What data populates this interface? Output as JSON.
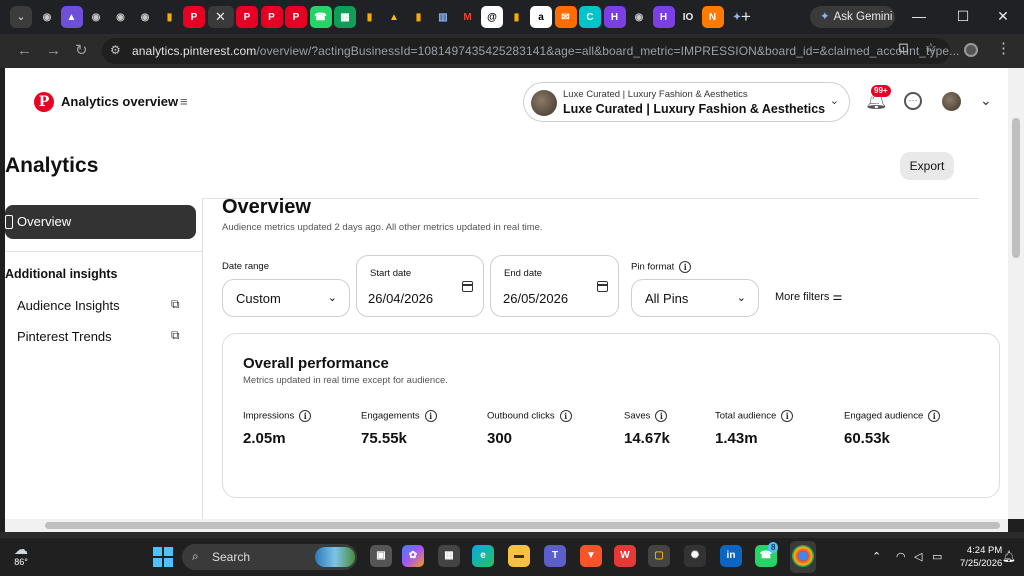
{
  "browser": {
    "tab_icons": [
      {
        "name": "chrome-tab-icon",
        "glyph": "◉",
        "color": "#c4c7c5",
        "bg": ""
      },
      {
        "name": "app-tab-icon",
        "glyph": "▲",
        "color": "#fff",
        "bg": "#6e4fd8"
      },
      {
        "name": "chrome-tab-icon",
        "glyph": "◉",
        "color": "#c4c7c5",
        "bg": ""
      },
      {
        "name": "chrome-tab-icon",
        "glyph": "◉",
        "color": "#c4c7c5",
        "bg": ""
      },
      {
        "name": "chrome-tab-icon",
        "glyph": "◉",
        "color": "#c4c7c5",
        "bg": ""
      },
      {
        "name": "analytics-tab-icon",
        "glyph": "▮",
        "color": "#f9ab00",
        "bg": ""
      },
      {
        "name": "pinterest-tab-icon",
        "glyph": "P",
        "color": "#fff",
        "bg": "#e60023"
      },
      {
        "name": "close-tab-icon",
        "glyph": "✕",
        "color": "#e8eaed",
        "bg": "",
        "active": true
      },
      {
        "name": "pinterest-tab-icon",
        "glyph": "P",
        "color": "#fff",
        "bg": "#e60023"
      },
      {
        "name": "pinterest-tab-icon",
        "glyph": "P",
        "color": "#fff",
        "bg": "#e60023"
      },
      {
        "name": "pinterest-tab-icon",
        "glyph": "P",
        "color": "#fff",
        "bg": "#e60023"
      },
      {
        "name": "whatsapp-tab-icon",
        "glyph": "☎",
        "color": "#fff",
        "bg": "#25d366"
      },
      {
        "name": "sheets-tab-icon",
        "glyph": "▦",
        "color": "#fff",
        "bg": "#0f9d58"
      },
      {
        "name": "analytics-tab-icon",
        "glyph": "▮",
        "color": "#f9ab00",
        "bg": ""
      },
      {
        "name": "ads-tab-icon",
        "glyph": "▲",
        "color": "#fbbc04",
        "bg": ""
      },
      {
        "name": "analytics-tab-icon",
        "glyph": "▮",
        "color": "#f9ab00",
        "bg": ""
      },
      {
        "name": "bank-tab-icon",
        "glyph": "▥",
        "color": "#8ab4f8",
        "bg": ""
      },
      {
        "name": "gmail-tab-icon",
        "glyph": "M",
        "color": "#ea4335",
        "bg": ""
      },
      {
        "name": "threads-tab-icon",
        "glyph": "@",
        "color": "#000",
        "bg": "#fff"
      },
      {
        "name": "analytics-tab-icon",
        "glyph": "▮",
        "color": "#f9ab00",
        "bg": ""
      },
      {
        "name": "amazon-tab-icon",
        "glyph": "a",
        "color": "#000",
        "bg": "#fff"
      },
      {
        "name": "mail-tab-icon",
        "glyph": "✉",
        "color": "#fff",
        "bg": "#ff6d00"
      },
      {
        "name": "canva-tab-icon",
        "glyph": "C",
        "color": "#fff",
        "bg": "#00c4cc"
      },
      {
        "name": "app-tab-icon",
        "glyph": "H",
        "color": "#fff",
        "bg": "#7b3fe4"
      },
      {
        "name": "chrome-tab-icon",
        "glyph": "◉",
        "color": "#c4c7c5",
        "bg": ""
      },
      {
        "name": "app-tab-icon",
        "glyph": "H",
        "color": "#fff",
        "bg": "#7b3fe4"
      },
      {
        "name": "io-tab-icon",
        "glyph": "IO",
        "color": "#e8eaed",
        "bg": ""
      },
      {
        "name": "app-tab-icon",
        "glyph": "N",
        "color": "#fff",
        "bg": "#ff7a00"
      },
      {
        "name": "gemini-tab-icon",
        "glyph": "✦",
        "color": "#8ab4f8",
        "bg": ""
      }
    ],
    "ask_gemini": "Ask Gemini",
    "url_host": "analytics.pinterest.com",
    "url_path": "/overview/?actingBusinessId=1081497435425283141&age=all&board_metric=IMPRESSION&board_id=&claimed_account_type..."
  },
  "header": {
    "app_title": "Analytics overview",
    "account_small": "Luxe Curated | Luxury Fashion & Aesthetics",
    "account_big": "Luxe Curated | Luxury Fashion & Aesthetics",
    "notification_badge": "99+",
    "page_heading": "Analytics",
    "export_label": "Export"
  },
  "sidebar": {
    "overview_label": "Overview",
    "section_title": "Additional insights",
    "items": [
      {
        "label": "Audience Insights"
      },
      {
        "label": "Pinterest Trends"
      }
    ]
  },
  "main": {
    "title": "Overview",
    "subtitle": "Audience metrics updated 2 days ago. All other metrics updated in real time.",
    "date_range_label": "Date range",
    "date_range_value": "Custom",
    "start_label": "Start date",
    "start_value": "26/04/2026",
    "end_label": "End date",
    "end_value": "26/05/2026",
    "pin_format_label": "Pin format",
    "pin_format_value": "All Pins",
    "more_filters": "More filters"
  },
  "performance": {
    "title": "Overall performance",
    "subtitle": "Metrics updated in real time except for audience.",
    "metrics": [
      {
        "label": "Impressions",
        "value": "2.05m"
      },
      {
        "label": "Engagements",
        "value": "75.55k"
      },
      {
        "label": "Outbound clicks",
        "value": "300"
      },
      {
        "label": "Saves",
        "value": "14.67k"
      },
      {
        "label": "Total audience",
        "value": "1.43m"
      },
      {
        "label": "Engaged audience",
        "value": "60.53k"
      }
    ]
  },
  "taskbar": {
    "temperature": "86°",
    "search_label": "Search",
    "whatsapp_badge": "8",
    "time": "4:24 PM",
    "date": "7/25/2026"
  }
}
